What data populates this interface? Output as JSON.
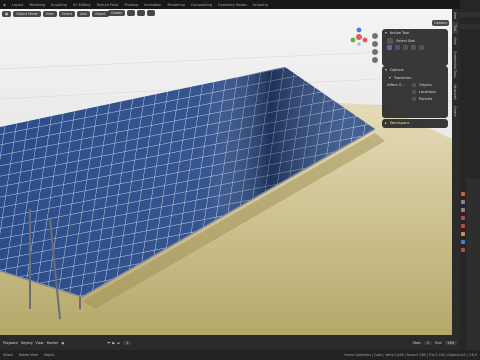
{
  "topbar": {
    "tabs": [
      "Layout",
      "Modeling",
      "Sculpting",
      "UV Editing",
      "Texture Paint",
      "Shading",
      "Animation",
      "Rendering",
      "Compositing",
      "Geometry Nodes",
      "Scripting"
    ],
    "active_tab_index": 0,
    "scene_label": "Scene"
  },
  "viewport": {
    "header": {
      "mode": "Object Mode",
      "view": "View",
      "select": "Select",
      "add": "Add",
      "object": "Object",
      "transform_orientation": "Global",
      "options": "Options"
    }
  },
  "active_tool_panel": {
    "title": "Active Tool",
    "tool": "Select Box"
  },
  "options_panel": {
    "title": "Options",
    "transform_title": "Transform",
    "affect_only_label": "Affect O...",
    "items": [
      "Origins",
      "Locations",
      "Parents"
    ]
  },
  "workspace_panel": {
    "title": "Workspace"
  },
  "side_tabs": [
    "Item",
    "Tool",
    "View",
    "Screenshot Tools",
    "MeasureIt",
    "Create"
  ],
  "timeline": {
    "playback": "Playback",
    "keying": "Keying",
    "view": "View",
    "marker": "Marker",
    "start_label": "Start",
    "start": "1",
    "end_label": "End",
    "end": "250",
    "current": "1"
  },
  "statusbar": {
    "select": "Select",
    "rotate": "Rotate View",
    "object": "Object",
    "stats": "Scene Collection | Cube | Verts:2,856 | Faces:2,564 | Tris:5,128 | Objects:0/3 | 3.6.0"
  },
  "colors": {
    "accent": "#4772b3",
    "panel_bg": "#2d2d2d",
    "ground": "#d8cda0",
    "solar_cell": "#2c4d8a"
  }
}
